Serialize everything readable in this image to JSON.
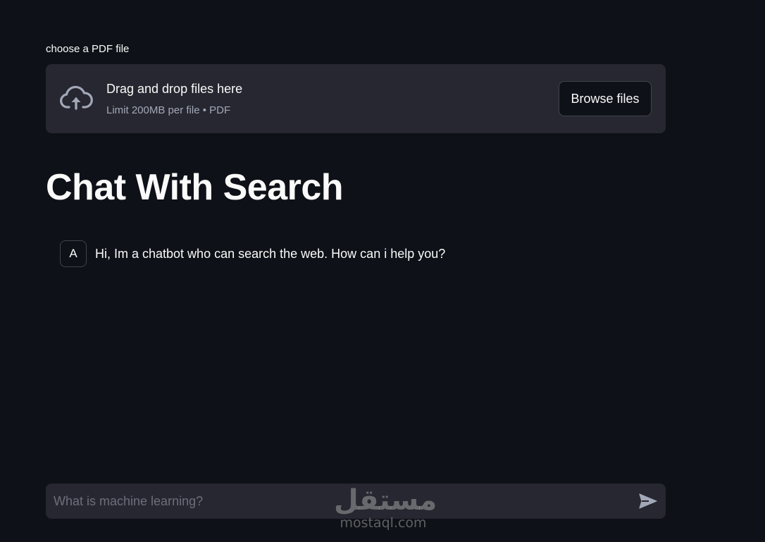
{
  "uploader": {
    "label": "choose a PDF file",
    "drop_title": "Drag and drop files here",
    "drop_subtitle": "Limit 200MB per file • PDF",
    "browse_label": "Browse files",
    "icon": "cloud-upload-icon"
  },
  "page": {
    "title": "Chat With Search"
  },
  "messages": [
    {
      "role": "assistant",
      "avatar": "A",
      "text": "Hi, Im a chatbot who can search the web. How can i help you?"
    }
  ],
  "chat_input": {
    "placeholder": "What is machine learning?",
    "value": "",
    "send_icon": "send-icon"
  },
  "watermark": {
    "arabic": "مستقل",
    "latin": "mostaql.com"
  },
  "colors": {
    "background": "#0e1117",
    "surface": "#262730",
    "text": "#fafafa",
    "muted": "#a3a8b8"
  }
}
